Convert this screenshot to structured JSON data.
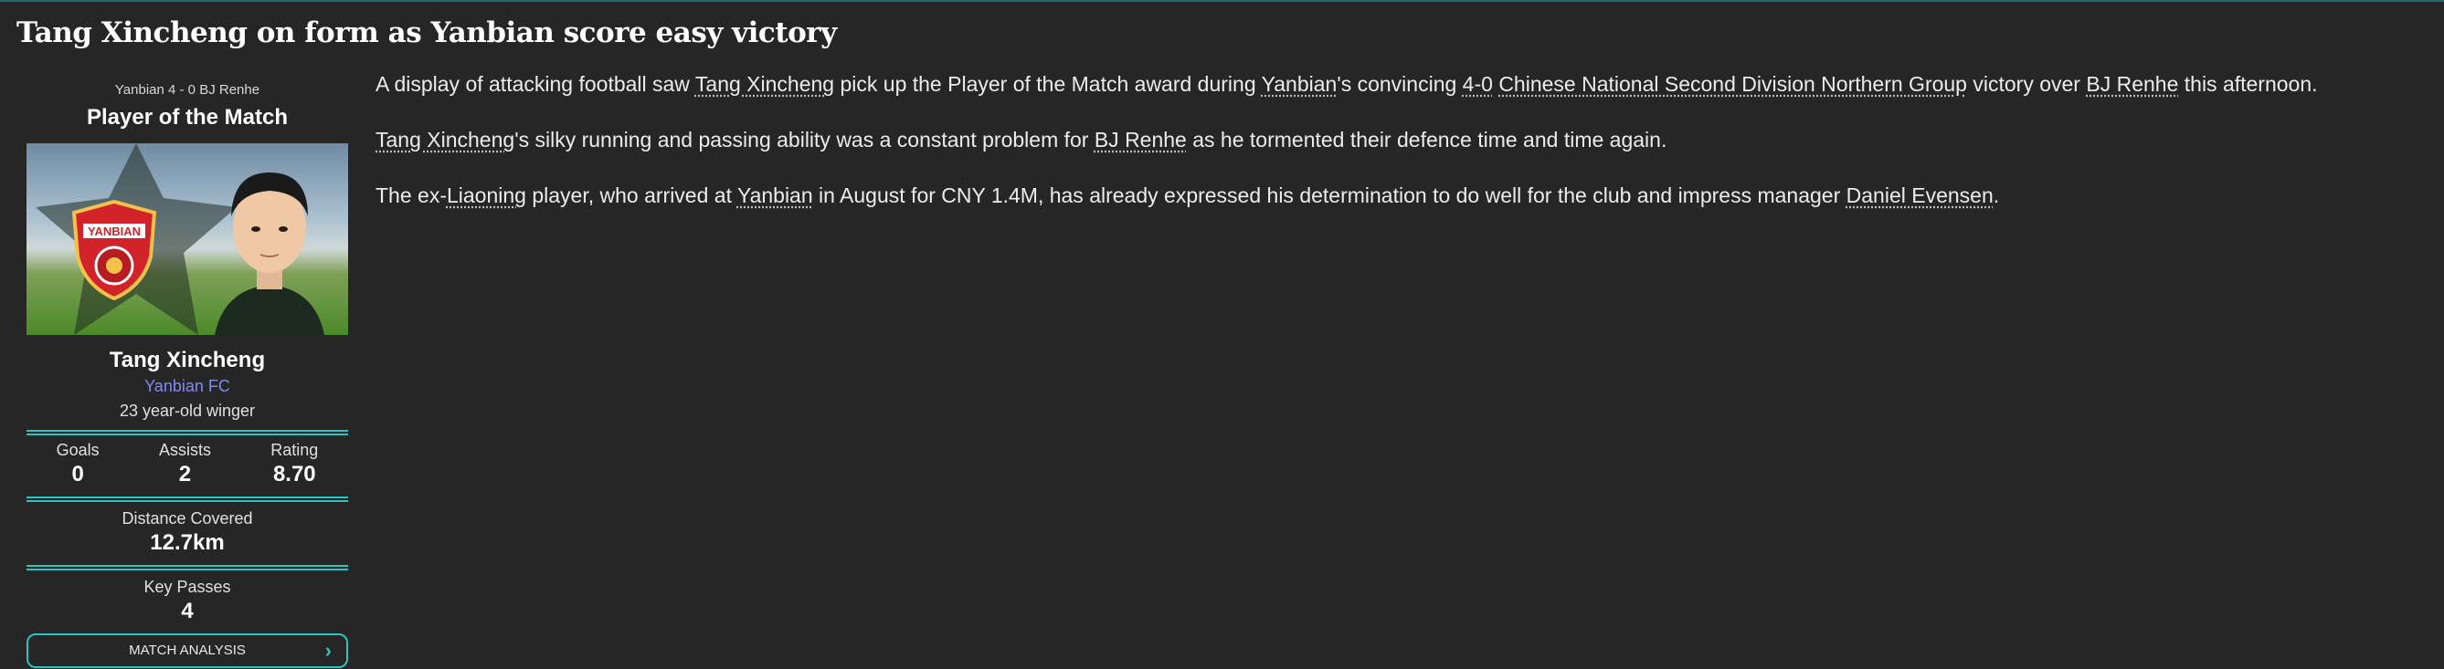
{
  "headline": "Tang Xincheng on form as Yanbian score easy victory",
  "sidebar": {
    "score_line": "Yanbian 4 - 0 BJ Renhe",
    "award_title": "Player of the Match",
    "crest_text": "YANBIAN",
    "player_name": "Tang Xincheng",
    "club": "Yanbian FC",
    "description": "23 year-old winger",
    "stats": [
      {
        "label": "Goals",
        "value": "0"
      },
      {
        "label": "Assists",
        "value": "2"
      },
      {
        "label": "Rating",
        "value": "8.70"
      }
    ],
    "distance": {
      "label": "Distance Covered",
      "value": "12.7km"
    },
    "key_passes": {
      "label": "Key Passes",
      "value": "4"
    },
    "button_label": "MATCH ANALYSIS",
    "button_icon": "chevron-right-icon"
  },
  "article": {
    "p1": {
      "t1": "A display of attacking football saw ",
      "l1": "Tang Xincheng",
      "t2": " pick up the Player of the Match award during ",
      "l2": "Yanbian",
      "t3": "'s convincing ",
      "l3": "4-0",
      "t4": " ",
      "l4": "Chinese National Second Division Northern Group",
      "t5": " victory over ",
      "l5": "BJ Renhe",
      "t6": " this afternoon."
    },
    "p2": {
      "l1": "Tang Xincheng",
      "t1": "'s silky running and passing ability was a constant problem for ",
      "l2": "BJ Renhe",
      "t2": " as he tormented their defence time and time again."
    },
    "p3": {
      "t1": "The ex-",
      "l1": "Liaoning",
      "t2": " player, who arrived at ",
      "l2": "Yanbian",
      "t3": " in August for CNY 1.4M, has already expressed his determination to do well for the club and impress manager ",
      "l3": "Daniel Evensen",
      "t4": "."
    }
  },
  "colors": {
    "accent": "#2bc4c0",
    "club_link": "#7f8bf0",
    "background": "#262626"
  }
}
